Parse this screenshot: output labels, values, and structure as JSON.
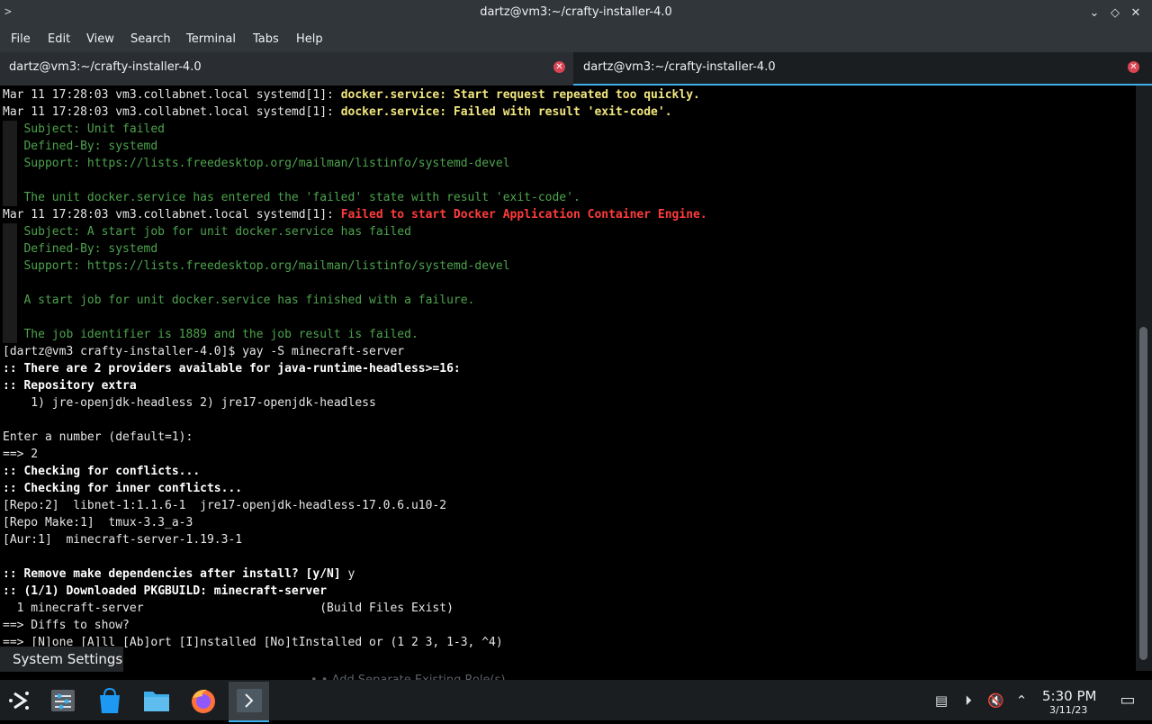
{
  "window": {
    "title": "dartz@vm3:~/crafty-installer-4.0",
    "buttons": {
      "minimize": "⌄",
      "maximize": "◇",
      "close": "✕"
    }
  },
  "menu": [
    "File",
    "Edit",
    "View",
    "Search",
    "Terminal",
    "Tabs",
    "Help"
  ],
  "tabs": [
    {
      "label": "dartz@vm3:~/crafty-installer-4.0",
      "active": false
    },
    {
      "label": "dartz@vm3:~/crafty-installer-4.0",
      "active": true
    }
  ],
  "terminal": {
    "lines": [
      {
        "segments": [
          {
            "t": "Mar 11 17:28:03 vm3.collabnet.local systemd[1]: ",
            "c": ""
          },
          {
            "t": "docker.service: Start request repeated too quickly.",
            "c": "y"
          }
        ]
      },
      {
        "segments": [
          {
            "t": "Mar 11 17:28:03 vm3.collabnet.local systemd[1]: ",
            "c": ""
          },
          {
            "t": "docker.service: Failed with result 'exit-code'.",
            "c": "y"
          }
        ]
      },
      {
        "segments": [
          {
            "t": "   Subject: Unit failed",
            "c": "g"
          }
        ]
      },
      {
        "segments": [
          {
            "t": "   Defined-By: systemd",
            "c": "g"
          }
        ]
      },
      {
        "segments": [
          {
            "t": "   Support: https://lists.freedesktop.org/mailman/listinfo/systemd-devel",
            "c": "g"
          }
        ]
      },
      {
        "segments": [
          {
            "t": "",
            "c": ""
          }
        ]
      },
      {
        "segments": [
          {
            "t": "   The unit docker.service has entered the 'failed' state with result 'exit-code'.",
            "c": "g"
          }
        ]
      },
      {
        "segments": [
          {
            "t": "Mar 11 17:28:03 vm3.collabnet.local systemd[1]: ",
            "c": ""
          },
          {
            "t": "Failed to start Docker Application Container Engine.",
            "c": "r"
          }
        ]
      },
      {
        "segments": [
          {
            "t": "   Subject: A start job for unit docker.service has failed",
            "c": "g"
          }
        ]
      },
      {
        "segments": [
          {
            "t": "   Defined-By: systemd",
            "c": "g"
          }
        ]
      },
      {
        "segments": [
          {
            "t": "   Support: https://lists.freedesktop.org/mailman/listinfo/systemd-devel",
            "c": "g"
          }
        ]
      },
      {
        "segments": [
          {
            "t": "",
            "c": ""
          }
        ]
      },
      {
        "segments": [
          {
            "t": "   A start job for unit docker.service has finished with a failure.",
            "c": "g"
          }
        ]
      },
      {
        "segments": [
          {
            "t": "",
            "c": ""
          }
        ]
      },
      {
        "segments": [
          {
            "t": "   The job identifier is 1889 and the job result is failed.",
            "c": "g"
          }
        ]
      },
      {
        "segments": [
          {
            "t": "[dartz@vm3 crafty-installer-4.0]$ yay -S minecraft-server",
            "c": ""
          }
        ]
      },
      {
        "segments": [
          {
            "t": ":: ",
            "c": "b"
          },
          {
            "t": "There are 2 providers available for java-runtime-headless>=16:",
            "c": "b"
          }
        ]
      },
      {
        "segments": [
          {
            "t": ":: ",
            "c": "b"
          },
          {
            "t": "Repository extra",
            "c": "b"
          }
        ]
      },
      {
        "segments": [
          {
            "t": "    1) jre-openjdk-headless 2) jre17-openjdk-headless",
            "c": ""
          }
        ]
      },
      {
        "segments": [
          {
            "t": "",
            "c": ""
          }
        ]
      },
      {
        "segments": [
          {
            "t": "Enter a number (default=1):",
            "c": ""
          }
        ]
      },
      {
        "segments": [
          {
            "t": "==> 2",
            "c": ""
          }
        ]
      },
      {
        "segments": [
          {
            "t": ":: ",
            "c": "b"
          },
          {
            "t": "Checking for conflicts...",
            "c": "b"
          }
        ]
      },
      {
        "segments": [
          {
            "t": ":: ",
            "c": "b"
          },
          {
            "t": "Checking for inner conflicts...",
            "c": "b"
          }
        ]
      },
      {
        "segments": [
          {
            "t": "[Repo:2]  libnet-1:1.1.6-1  jre17-openjdk-headless-17.0.6.u10-2",
            "c": ""
          }
        ]
      },
      {
        "segments": [
          {
            "t": "[Repo Make:1]  tmux-3.3_a-3",
            "c": ""
          }
        ]
      },
      {
        "segments": [
          {
            "t": "[Aur:1]  minecraft-server-1.19.3-1",
            "c": ""
          }
        ]
      },
      {
        "segments": [
          {
            "t": "",
            "c": ""
          }
        ]
      },
      {
        "segments": [
          {
            "t": ":: ",
            "c": "b"
          },
          {
            "t": "Remove make dependencies after install? [y/N]",
            "c": "b"
          },
          {
            "t": " y",
            "c": ""
          }
        ]
      },
      {
        "segments": [
          {
            "t": ":: ",
            "c": "b"
          },
          {
            "t": "(1/1) Downloaded PKGBUILD: minecraft-server",
            "c": "b"
          }
        ]
      },
      {
        "segments": [
          {
            "t": "  1 minecraft-server                         (Build Files Exist)",
            "c": ""
          }
        ]
      },
      {
        "segments": [
          {
            "t": "==> Diffs to show?",
            "c": ""
          }
        ]
      },
      {
        "segments": [
          {
            "t": "==> [N]one [A]ll [Ab]ort [I]nstalled [No]tInstalled or (1 2 3, 1-3, ^4)",
            "c": ""
          }
        ]
      },
      {
        "segments": [
          {
            "t": "==> ",
            "c": ""
          }
        ]
      }
    ]
  },
  "tooltip": "System Settings",
  "ghost_text": "• • Add Separate Existing Role(s)",
  "taskbar": {
    "apps": [
      {
        "name": "application-launcher-icon"
      },
      {
        "name": "system-settings-icon"
      },
      {
        "name": "discover-store-icon"
      },
      {
        "name": "file-manager-icon"
      },
      {
        "name": "firefox-icon"
      },
      {
        "name": "konsole-icon"
      }
    ],
    "tray": {
      "clipboard": "▤",
      "media": "⏵",
      "volume": "🔇",
      "expand": "⌃",
      "desktop": "▭"
    },
    "time": "5:30 PM",
    "date": "3/11/23"
  }
}
